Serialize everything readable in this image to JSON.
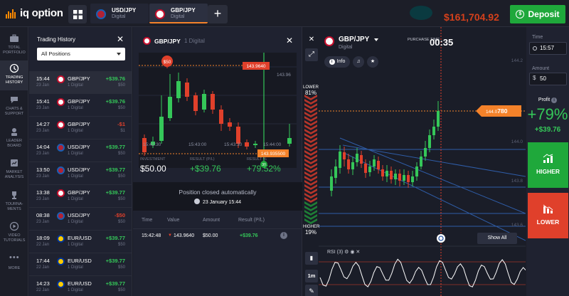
{
  "topbar": {
    "logo_text": "iq option",
    "tabs": [
      {
        "pair": "USD/JPY",
        "sub": "Digital",
        "active": false
      },
      {
        "pair": "GBP/JPY",
        "sub": "Digital",
        "active": true
      }
    ],
    "add_tab": "+",
    "balance": "$161,704.92",
    "deposit_label": "Deposit"
  },
  "leftnav": [
    {
      "label": "TOTAL PORTFOLIO",
      "icon": "briefcase-icon"
    },
    {
      "label": "TRADING HISTORY",
      "icon": "history-icon",
      "active": true
    },
    {
      "label": "CHATS & SUPPORT",
      "icon": "chat-icon"
    },
    {
      "label": "LEADER BOARD",
      "icon": "leaderboard-icon"
    },
    {
      "label": "MARKET ANALYSIS",
      "icon": "analysis-icon"
    },
    {
      "label": "TOURNA-MENTS",
      "icon": "trophy-icon"
    },
    {
      "label": "VIDEO TUTORIALS",
      "icon": "play-icon"
    },
    {
      "label": "MORE",
      "icon": "more-icon"
    }
  ],
  "history": {
    "title": "Trading History",
    "filter": "All Positions",
    "rows": [
      {
        "time": "15:44",
        "date": "23 Jan",
        "pair": "GBP/JPY",
        "kind": "1 Digital",
        "result": "+$39.76",
        "investment": "$50",
        "flag": "gbp",
        "positive": true
      },
      {
        "time": "15:41",
        "date": "23 Jan",
        "pair": "GBP/JPY",
        "kind": "1 Digital",
        "result": "+$39.76",
        "investment": "$50",
        "flag": "gbp",
        "positive": true
      },
      {
        "time": "14:27",
        "date": "23 Jan",
        "pair": "GBP/JPY",
        "kind": "1 Digital",
        "result": "-$1",
        "investment": "$1",
        "flag": "gbp",
        "positive": false
      },
      {
        "time": "14:04",
        "date": "23 Jan",
        "pair": "USD/JPY",
        "kind": "1 Digital",
        "result": "+$39.77",
        "investment": "$50",
        "flag": "usd",
        "positive": true
      },
      {
        "time": "13:50",
        "date": "23 Jan",
        "pair": "USD/JPY",
        "kind": "1 Digital",
        "result": "+$39.77",
        "investment": "$50",
        "flag": "usd",
        "positive": true
      },
      {
        "time": "13:38",
        "date": "23 Jan",
        "pair": "GBP/JPY",
        "kind": "1 Digital",
        "result": "+$39.77",
        "investment": "$50",
        "flag": "gbp",
        "positive": true
      },
      {
        "time": "08:38",
        "date": "23 Jan",
        "pair": "USD/JPY",
        "kind": "1 Digital",
        "result": "-$50",
        "investment": "$50",
        "flag": "usd",
        "positive": false
      },
      {
        "time": "18:09",
        "date": "22 Jan",
        "pair": "EUR/USD",
        "kind": "1 Digital",
        "result": "+$39.77",
        "investment": "$50",
        "flag": "eur",
        "positive": true
      },
      {
        "time": "17:44",
        "date": "22 Jan",
        "pair": "EUR/USD",
        "kind": "1 Digital",
        "result": "+$39.77",
        "investment": "$50",
        "flag": "eur",
        "positive": true
      },
      {
        "time": "14:23",
        "date": "22 Jan",
        "pair": "EUR/USD",
        "kind": "1 Digital",
        "result": "+$39.77",
        "investment": "$50",
        "flag": "eur",
        "positive": true
      }
    ]
  },
  "deal": {
    "pair": "GBP/JPY",
    "kind": "1 Digital",
    "mini_chart": {
      "entry_badge": "$50",
      "open_price": "143.9640",
      "level_label": "143.96",
      "close_price": "143.935500",
      "close_badge": "30",
      "times": [
        "15:42:30",
        "15:43:00",
        "15:43:30",
        "15:44:00"
      ]
    },
    "investment_label": "INVESTMENT",
    "investment": "$50.00",
    "result_label": "RESULT (P/L)",
    "result": "+$39.76",
    "result_pct_label": "RESULT %",
    "result_pct": "+79.52%",
    "closed_msg": "Position closed automatically",
    "closed_when": "23 January 15:44",
    "table_headers": [
      "Time",
      "Value",
      "Amount",
      "Result (P/L)"
    ],
    "table_row": {
      "time": "15:42:48",
      "value": "143.9640",
      "amount": "$50.00",
      "result": "+$39.76"
    }
  },
  "main": {
    "pair": "GBP/JPY",
    "kind": "Digital",
    "info_label": "Info",
    "purchase_label": "PURCHASE TIME",
    "purchase_time": "00:35",
    "lower_label": "LOWER",
    "lower_pct": "81%",
    "higher_label": "HIGHER",
    "higher_pct": "19%",
    "price_tag_prefix": "144.0",
    "price_tag_bold": "780",
    "y_ticks": [
      "144.2",
      "144.0",
      "143.8",
      "143.6"
    ],
    "show_all": "Show All",
    "rsi_label": "RSI (3)",
    "timeframe": "1m"
  },
  "right": {
    "time_label": "Time",
    "time_value": "15:57",
    "amount_label": "Amount",
    "amount_value": "50",
    "profit_label": "Profit",
    "profit_pct": "+79%",
    "profit_amount": "+$39.76",
    "higher_label": "HIGHER",
    "lower_label": "LOWER"
  },
  "colors": {
    "accent_orange": "#f4822a",
    "green": "#1fa83b",
    "red": "#e0402b",
    "bg": "#1b1d27"
  }
}
